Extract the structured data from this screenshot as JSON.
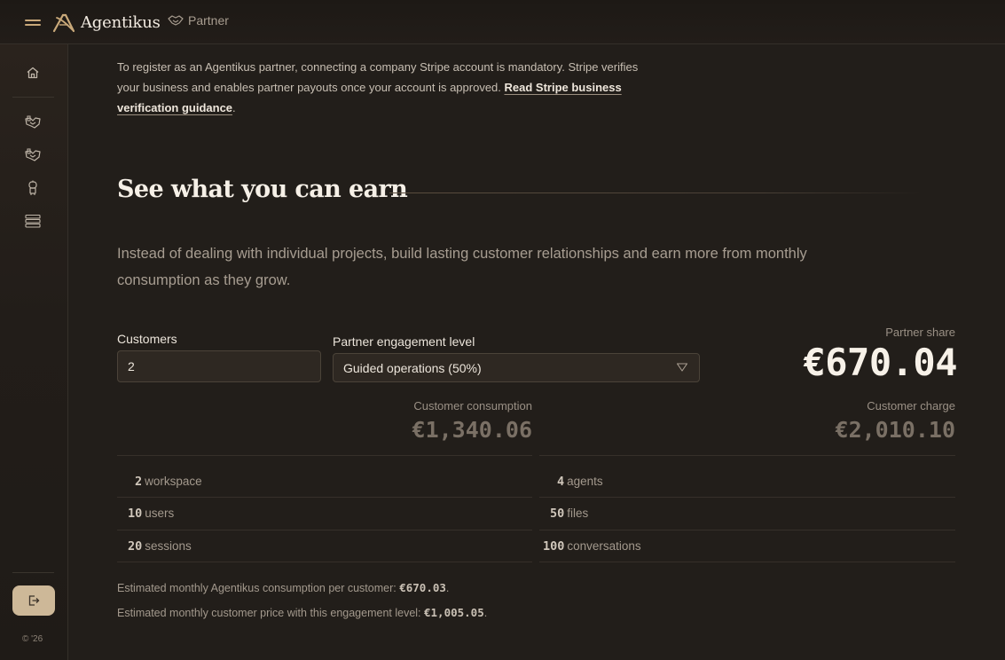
{
  "header": {
    "brand": "Agentikus",
    "breadcrumb": "Partner"
  },
  "sidebar": {
    "items": [
      {
        "icon": "home-icon"
      },
      {
        "icon": "handshake-icon"
      },
      {
        "icon": "handshake-icon"
      },
      {
        "icon": "robot-icon"
      },
      {
        "icon": "stack-icon"
      }
    ],
    "logout_icon": "logout-icon",
    "copyright": "© '26"
  },
  "intro": {
    "line1": "To register as an Agentikus partner, connecting a company Stripe account is mandatory. Stripe verifies your business and enables partner payouts once your account is approved. ",
    "link": "Read Stripe business verification guidance",
    "after": "."
  },
  "section": {
    "title": "See what you can earn",
    "lead": "Instead of dealing with individual projects, build lasting customer relationships and earn more from monthly consumption as they grow."
  },
  "form": {
    "customers_label": "Customers",
    "customers_value": "2",
    "engagement_label": "Partner engagement level",
    "engagement_value": "Guided operations (50%)"
  },
  "results": {
    "share_label": "Partner share",
    "share_value": "€670.04",
    "consumption_label": "Customer consumption",
    "consumption_value": "€1,340.06",
    "charge_label": "Customer charge",
    "charge_value": "€2,010.10"
  },
  "breakdown": [
    {
      "num": "2",
      "label": "workspace"
    },
    {
      "num": "4",
      "label": "agents"
    },
    {
      "num": "10",
      "label": "users"
    },
    {
      "num": "50",
      "label": "files"
    },
    {
      "num": "20",
      "label": "sessions"
    },
    {
      "num": "100",
      "label": "conversations"
    }
  ],
  "notes": {
    "consumption_text": "Estimated monthly Agentikus consumption per customer: ",
    "consumption_value": "€670.03",
    "price_text": "Estimated monthly customer price with this engagement level: ",
    "price_value": "€1,005.05",
    "period": "."
  },
  "colors": {
    "accent": "#c9a97a",
    "background": "#221e1a",
    "logout_button": "#cdb898"
  }
}
